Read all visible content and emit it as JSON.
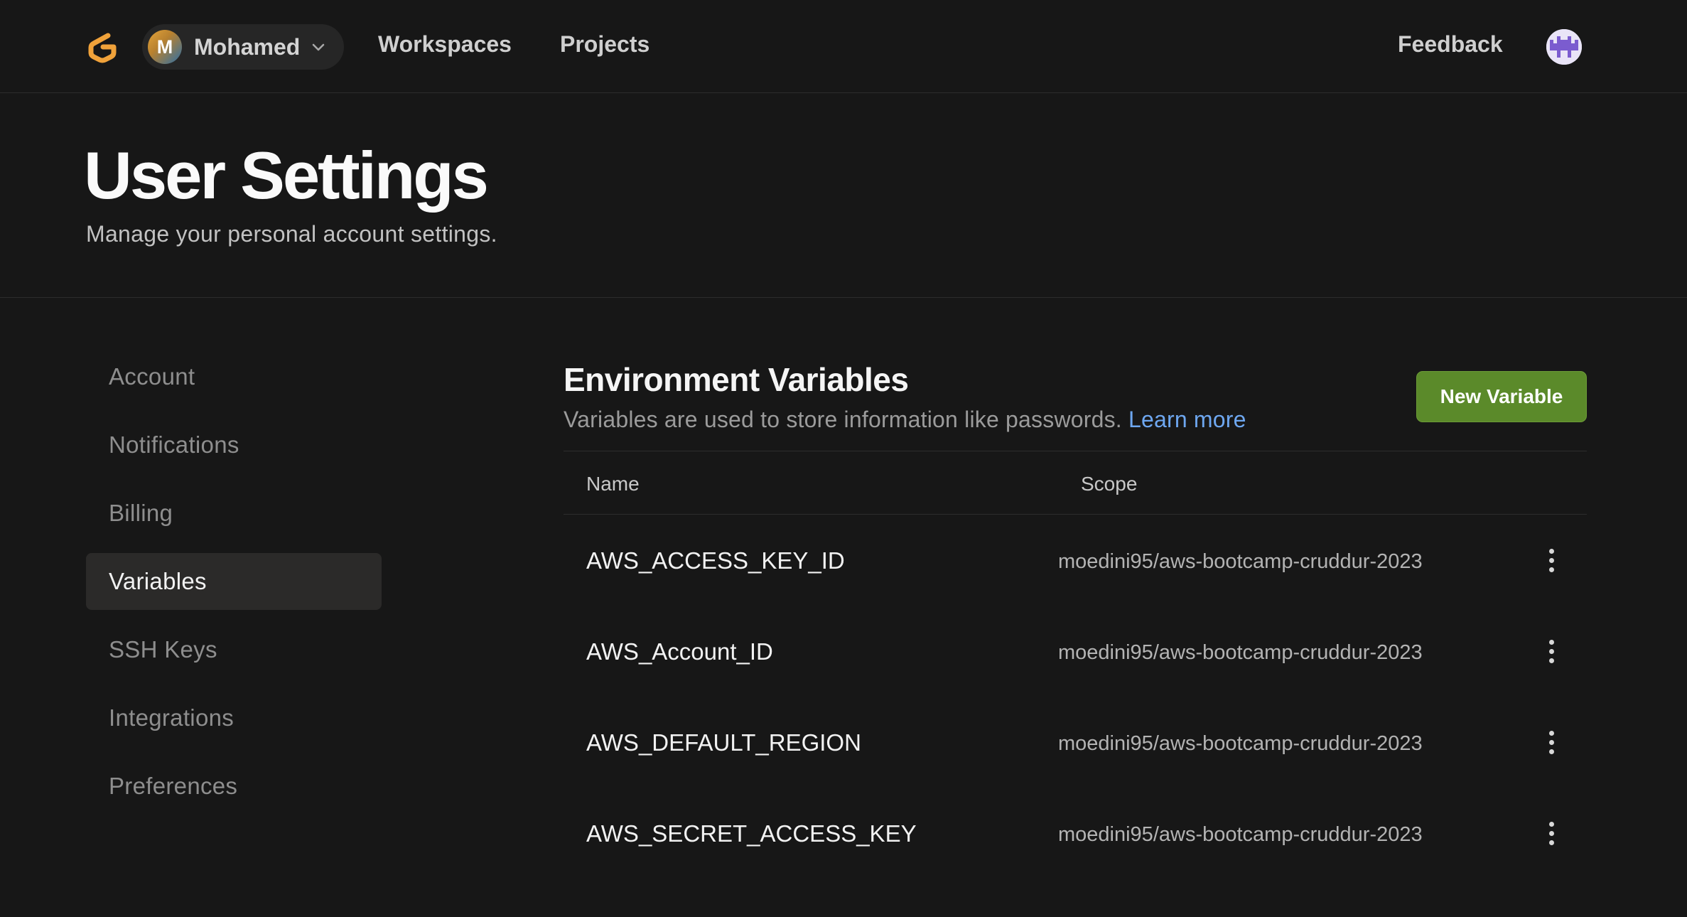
{
  "topbar": {
    "user_initial": "M",
    "user_name": "Mohamed",
    "nav": {
      "workspaces": "Workspaces",
      "projects": "Projects",
      "feedback": "Feedback"
    }
  },
  "header": {
    "title": "User Settings",
    "subtitle": "Manage your personal account settings."
  },
  "sidebar": {
    "items": [
      {
        "label": "Account",
        "active": false
      },
      {
        "label": "Notifications",
        "active": false
      },
      {
        "label": "Billing",
        "active": false
      },
      {
        "label": "Variables",
        "active": true
      },
      {
        "label": "SSH Keys",
        "active": false
      },
      {
        "label": "Integrations",
        "active": false
      },
      {
        "label": "Preferences",
        "active": false
      }
    ]
  },
  "main": {
    "title": "Environment Variables",
    "description": "Variables are used to store information like passwords.",
    "learn_more": "Learn more",
    "new_variable_button": "New Variable",
    "table": {
      "headers": {
        "name": "Name",
        "scope": "Scope"
      },
      "rows": [
        {
          "name": "AWS_ACCESS_KEY_ID",
          "scope": "moedini95/aws-bootcamp-cruddur-2023"
        },
        {
          "name": "AWS_Account_ID",
          "scope": "moedini95/aws-bootcamp-cruddur-2023"
        },
        {
          "name": "AWS_DEFAULT_REGION",
          "scope": "moedini95/aws-bootcamp-cruddur-2023"
        },
        {
          "name": "AWS_SECRET_ACCESS_KEY",
          "scope": "moedini95/aws-bootcamp-cruddur-2023"
        }
      ]
    }
  },
  "colors": {
    "background": "#171717",
    "accent_button": "#5b8a2a",
    "link": "#6ea7f0",
    "logo": "#f0a23a"
  },
  "icons": [
    "gitpod-logo-icon",
    "chevron-down-icon",
    "user-avatar-icon",
    "more-vertical-icon"
  ]
}
